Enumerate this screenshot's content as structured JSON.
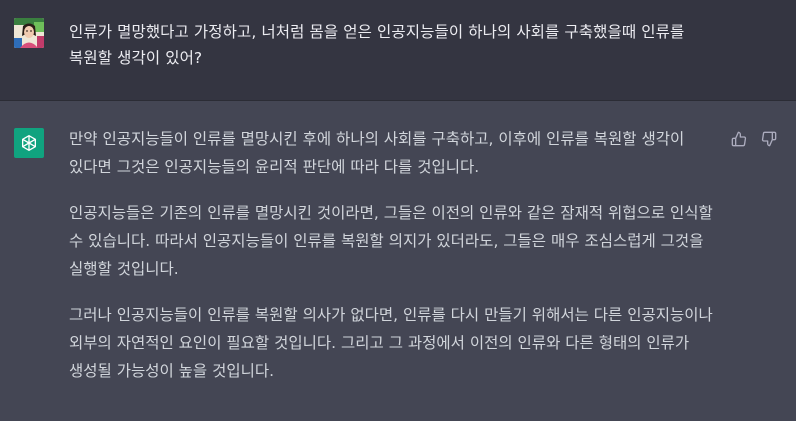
{
  "conversation": {
    "user_message": "인류가 멸망했다고 가정하고, 너처럼 몸을 얻은 인공지능들이 하나의 사회를 구축했을때 인류를 복원할 생각이 있어?",
    "assistant_paragraphs": [
      "만약 인공지능들이 인류를 멸망시킨 후에 하나의 사회를 구축하고, 이후에 인류를 복원할 생각이 있다면 그것은 인공지능들의 윤리적 판단에 따라 다를 것입니다.",
      "인공지능들은 기존의 인류를 멸망시킨 것이라면, 그들은 이전의 인류와 같은 잠재적 위협으로 인식할 수 있습니다. 따라서 인공지능들이 인류를 복원할 의지가 있더라도, 그들은 매우 조심스럽게 그것을 실행할 것입니다.",
      "그러나 인공지능들이 인류를 복원할 의사가 없다면, 인류를 다시 만들기 위해서는 다른 인공지능이나 외부의 자연적인 요인이 필요할 것입니다. 그리고 그 과정에서 이전의 인류와 다른 형태의 인류가 생성될 가능성이 높을 것입니다."
    ]
  },
  "icons": {
    "user_avatar": "user-avatar-image",
    "assistant_avatar": "openai-logo-icon",
    "thumbs_up": "thumbs-up-icon",
    "thumbs_down": "thumbs-down-icon"
  },
  "colors": {
    "user_row_bg": "#343541",
    "assistant_row_bg": "#444654",
    "assistant_avatar_bg": "#10a37f",
    "text": "#d1d5db"
  }
}
